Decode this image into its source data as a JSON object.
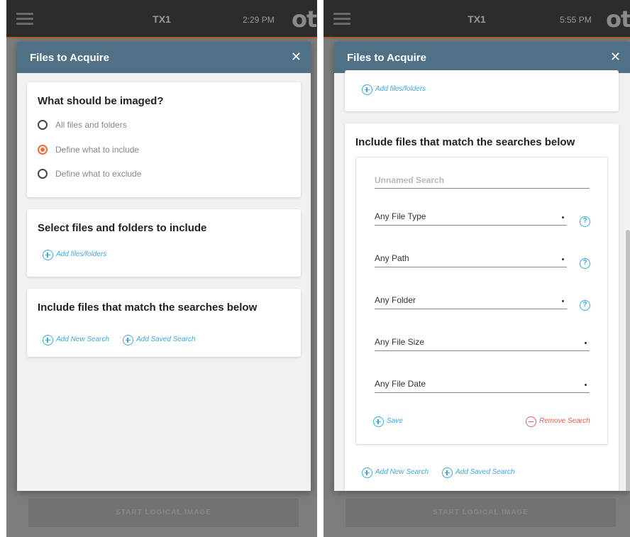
{
  "left": {
    "topbar": {
      "title": "TX1",
      "time": "2:29 PM",
      "logo": "ot"
    },
    "footer": {
      "label": "START LOGICAL IMAGE"
    },
    "modal": {
      "title": "Files to Acquire",
      "close": "✕",
      "imaged_card": {
        "title": "What should be imaged?",
        "options": [
          {
            "label": "All files and folders",
            "selected": false
          },
          {
            "label": "Define what to include",
            "selected": true
          },
          {
            "label": "Define what to exclude",
            "selected": false
          }
        ]
      },
      "select_card": {
        "title": "Select files and folders to include",
        "add_label": "Add files/folders"
      },
      "search_card": {
        "title": "Include files that match the searches below",
        "add_new_label": "Add New Search",
        "add_saved_label": "Add Saved Search"
      }
    }
  },
  "right": {
    "topbar": {
      "title": "TX1",
      "time": "5:55 PM",
      "logo": "ot"
    },
    "footer": {
      "label": "START LOGICAL IMAGE"
    },
    "modal": {
      "title": "Files to Acquire",
      "close": "✕",
      "add_files_label": "Add files/folders",
      "search_card": {
        "title": "Include files that match the searches below",
        "search_name_placeholder": "Unnamed Search",
        "fields": {
          "file_type": "Any File Type",
          "path": "Any Path",
          "folder": "Any Folder",
          "file_size": "Any File Size",
          "file_date": "Any File Date"
        },
        "help_symbol": "?",
        "save_label": "Save",
        "remove_label": "Remove Search",
        "add_new_label": "Add New Search",
        "add_saved_label": "Add Saved Search"
      }
    }
  },
  "colors": {
    "accent": "#ef6c3a",
    "link": "#3aa9dc",
    "danger": "#e85a4f",
    "modal_header": "#4f7086",
    "topbar": "#2c2c2c"
  },
  "icons": [
    "hamburger-menu-icon",
    "close-icon",
    "plus-circle-icon",
    "minus-circle-icon",
    "help-icon",
    "dropdown-dot-icon"
  ]
}
